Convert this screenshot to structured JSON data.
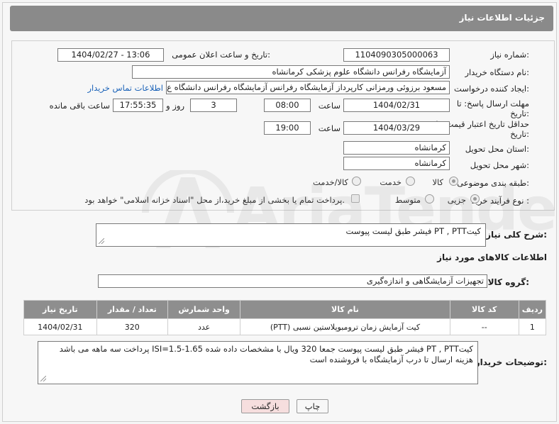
{
  "header": {
    "title": "جزئیات اطلاعات نیاز"
  },
  "fields": {
    "need_number_label": "شماره نیاز:",
    "need_number": "1104090305000063",
    "announce_label": "تاریخ و ساعت اعلان عمومی:",
    "announce_value": "1404/02/27 - 13:06",
    "buyer_org_label": "نام دستگاه خریدار:",
    "buyer_org": "آزمایشگاه رفرانس دانشگاه علوم پزشکی کرمانشاه",
    "creator_label": "ایجاد کننده درخواست:",
    "creator": "مسعود برزوئی ورمزانی کارپرداز آزمایشگاه رفرانس آزمایشگاه رفرانس دانشگاه ع",
    "contact_link": "اطلاعات تماس خریدار",
    "deadline_label": "مهلت ارسال پاسخ: تا تاریخ:",
    "deadline_date": "1404/02/31",
    "time_label": "ساعت",
    "deadline_time": "08:00",
    "days_value": "3",
    "days_label": "روز و",
    "remaining_time": "17:55:35",
    "remaining_label": "ساعت باقی مانده",
    "validity_label": "حداقل تاریخ اعتبار قیمت: تا تاریخ:",
    "validity_date": "1404/03/29",
    "validity_time": "19:00",
    "province_label": "استان محل تحویل:",
    "province": "کرمانشاه",
    "city_label": "شهر محل تحویل:",
    "city": "کرمانشاه",
    "category_label": "طبقه بندی موضوعی:",
    "category_options": [
      "کالا",
      "خدمت",
      "کالا/خدمت"
    ],
    "process_label": "نوع فرآیند خرید :",
    "process_options": [
      "جزیی",
      "متوسط"
    ],
    "payment_note": "پرداخت تمام یا بخشی از مبلغ خرید،از محل \"اسناد خزانه اسلامی\" خواهد بود."
  },
  "summary": {
    "label": "شرح کلی نیاز:",
    "value": "کیتPT , PTT فیشر طبق لیست پیوست"
  },
  "goods": {
    "section_title": "اطلاعات کالاهای مورد نیاز",
    "group_label": "گروه کالا:",
    "group_value": "تجهیزات آزمایشگاهی و اندازه‌گیری",
    "columns": [
      "ردیف",
      "کد کالا",
      "نام کالا",
      "واحد شمارش",
      "تعداد / مقدار",
      "تاریخ نیاز"
    ],
    "rows": [
      {
        "row": "1",
        "code": "--",
        "name": "کیت آزمایش زمان ترومبوپلاستین نسبی (PTT)",
        "unit": "عدد",
        "qty": "320",
        "date": "1404/02/31"
      }
    ]
  },
  "buyer_notes": {
    "label": "توضیحات خریدار:",
    "value": "کیتPT , PTT فیشر طبق لیست پیوست جمعا 320 ویال با مشخصات داده شده ISI=1.5-1.65 پرداخت سه ماهه می باشد هزینه ارسال تا درب آزمایشگاه با فروشنده است"
  },
  "buttons": {
    "print": "چاپ",
    "back": "بازگشت"
  },
  "watermark": {
    "text": "AriaTender.neT"
  },
  "colors": {
    "header_bg": "#8a8a8a",
    "table_header_bg": "#8e8e8e",
    "link": "#1a62b8",
    "back_button_bg": "#f6dede"
  }
}
